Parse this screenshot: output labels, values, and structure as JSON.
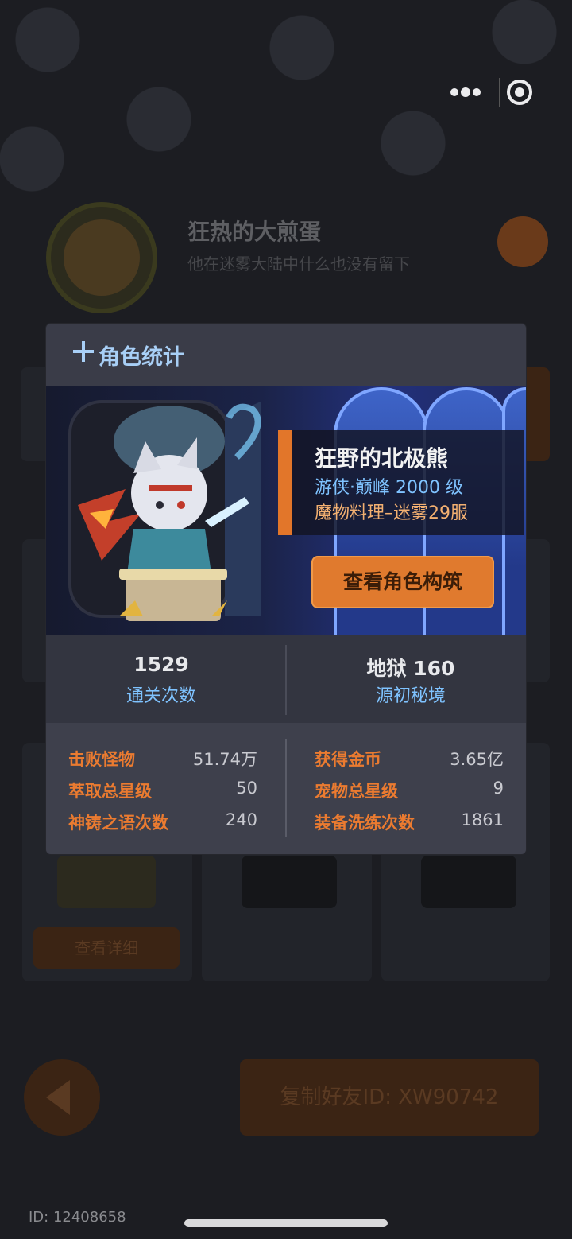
{
  "background": {
    "user_name": "狂热的大煎蛋",
    "user_subtitle": "他在迷雾大陆中什么也没有留下",
    "detail_button": "查看详细",
    "copy_friend_id": "复制好友ID: XW90742",
    "user_id": "ID: 12408658"
  },
  "capsule": {
    "menu_icon": "more-dots-icon",
    "close_icon": "target-icon"
  },
  "modal": {
    "title": "角色统计",
    "title_icon": "plus-icon",
    "character": {
      "name": "狂野的北极熊",
      "class_level": "游侠·巅峰 2000 级",
      "server": "魔物料理–迷雾29服"
    },
    "build_button": "查看角色构筑",
    "summary": [
      {
        "value": "1529",
        "label": "通关次数"
      },
      {
        "value": "地狱 160",
        "label": "源初秘境"
      }
    ],
    "stats_left": [
      {
        "label": "击败怪物",
        "value": "51.74万"
      },
      {
        "label": "萃取总星级",
        "value": "50"
      },
      {
        "label": "神铸之语次数",
        "value": "240"
      }
    ],
    "stats_right": [
      {
        "label": "获得金币",
        "value": "3.65亿"
      },
      {
        "label": "宠物总星级",
        "value": "9"
      },
      {
        "label": "装备洗练次数",
        "value": "1861"
      }
    ]
  },
  "colors": {
    "accent_orange": "#e07a2e",
    "title_blue": "#a8cff6",
    "label_orange": "#eb7b30",
    "value_blue": "#7fc3ff"
  }
}
